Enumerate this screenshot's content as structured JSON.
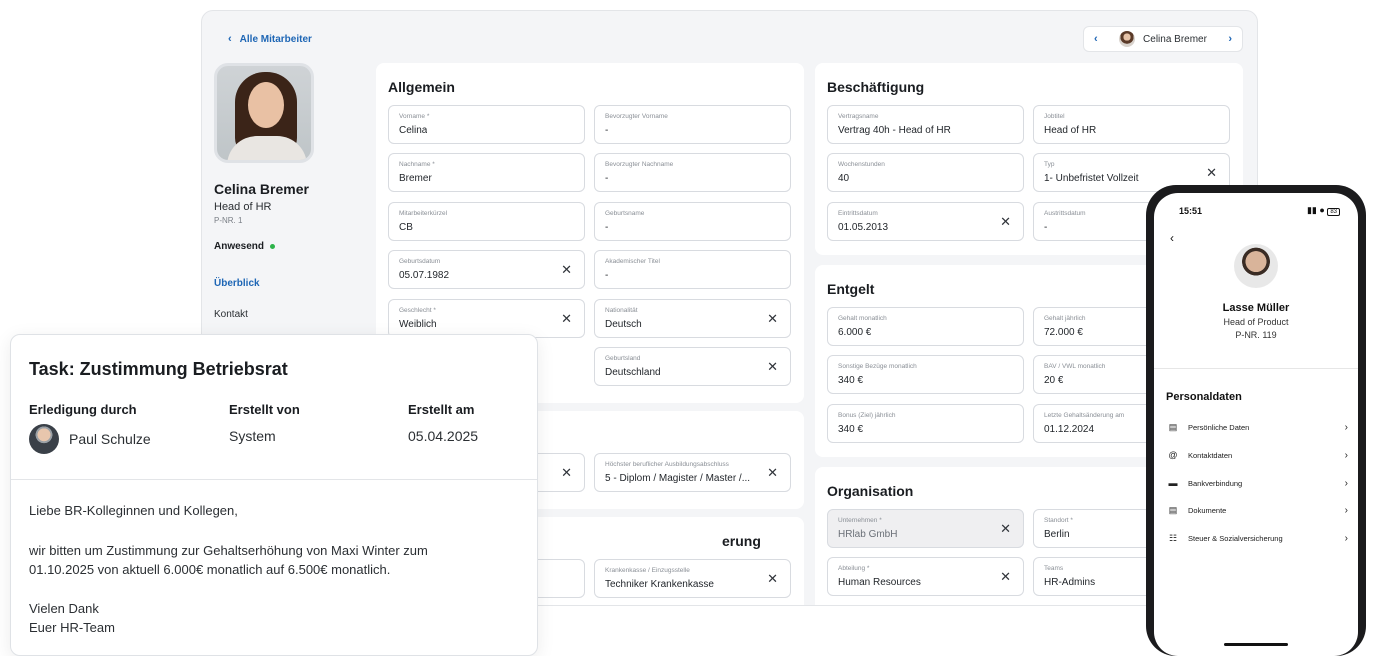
{
  "header": {
    "back_label": "Alle Mitarbeiter",
    "pager_name": "Celina Bremer"
  },
  "profile": {
    "name": "Celina Bremer",
    "role": "Head of HR",
    "nr": "P-NR. 1",
    "status": "Anwesend",
    "nav": [
      "Überblick",
      "Kontakt"
    ]
  },
  "allgemein": {
    "title": "Allgemein",
    "fields": [
      {
        "label": "Vorname *",
        "value": "Celina"
      },
      {
        "label": "Bevorzugter Vorname",
        "value": "-"
      },
      {
        "label": "Nachname *",
        "value": "Bremer"
      },
      {
        "label": "Bevorzugter Nachname",
        "value": "-"
      },
      {
        "label": "Mitarbeiterkürzel",
        "value": "CB"
      },
      {
        "label": "Geburtsname",
        "value": "-"
      },
      {
        "label": "Geburtsdatum",
        "value": "05.07.1982"
      },
      {
        "label": "Akademischer Titel",
        "value": "-"
      },
      {
        "label": "Geschlecht *",
        "value": "Weiblich"
      },
      {
        "label": "Nationalität",
        "value": "Deutsch"
      },
      {
        "label": "Geburtsland",
        "value": "Deutschland"
      }
    ]
  },
  "bildung": {
    "fields": [
      {
        "label": "Höchster beruflicher Ausbildungsabschluss",
        "value": "5 - Diplom / Magister / Master /..."
      }
    ]
  },
  "sozial": {
    "title_fragment": "erung",
    "fields": [
      {
        "label": "Krankenkasse / Einzugsstelle",
        "value": "Techniker Krankenkasse"
      }
    ]
  },
  "beschaeftigung": {
    "title": "Beschäftigung",
    "fields": [
      {
        "label": "Vertragsname",
        "value": "Vertrag 40h - Head of HR"
      },
      {
        "label": "Jobtitel",
        "value": "Head of HR"
      },
      {
        "label": "Wochenstunden",
        "value": "40"
      },
      {
        "label": "Typ",
        "value": "1- Unbefristet Vollzeit"
      },
      {
        "label": "Eintrittsdatum",
        "value": "01.05.2013"
      },
      {
        "label": "Austrittsdatum",
        "value": "-"
      }
    ]
  },
  "entgelt": {
    "title": "Entgelt",
    "fields": [
      {
        "label": "Gehalt monatlich",
        "value": "6.000 €"
      },
      {
        "label": "Gehalt jährlich",
        "value": "72.000 €"
      },
      {
        "label": "Sonstige Bezüge monatlich",
        "value": "340 €"
      },
      {
        "label": "BAV / VWL monatlich",
        "value": "20 €"
      },
      {
        "label": "Bonus (Ziel) jährlich",
        "value": "340 €"
      },
      {
        "label": "Letzte Gehaltsänderung am",
        "value": "01.12.2024"
      }
    ]
  },
  "organisation": {
    "title": "Organisation",
    "fields": [
      {
        "label": "Unternehmen *",
        "value": "HRlab GmbH"
      },
      {
        "label": "Standort *",
        "value": "Berlin"
      },
      {
        "label": "Abteilung *",
        "value": "Human Resources"
      },
      {
        "label": "Teams",
        "value": "HR-Admins"
      }
    ]
  },
  "task": {
    "title": "Task: Zustimmung Betriebsrat",
    "col1_label": "Erledigung durch",
    "col1_value": "Paul Schulze",
    "col2_label": "Erstellt von",
    "col2_value": "System",
    "col3_label": "Erstellt am",
    "col3_value": "05.04.2025",
    "greeting": "Liebe BR-Kolleginnen und Kollegen,",
    "body_line1": "wir bitten um Zustimmung zur Gehaltserhöhung von Maxi Winter zum",
    "body_line2": "01.10.2025 von aktuell 6.000€ monatlich auf 6.500€ monatlich.",
    "closing1": "Vielen Dank",
    "closing2": "Euer HR-Team"
  },
  "phone": {
    "time": "15:51",
    "status_icons": "signal wifi battery",
    "battery": "83",
    "name": "Lasse Müller",
    "role": "Head of Product",
    "nr": "P-NR. 119",
    "section": "Personaldaten",
    "items": [
      {
        "label": "Persönliche Daten",
        "icon": "id-card-icon"
      },
      {
        "label": "Kontaktdaten",
        "icon": "at-icon"
      },
      {
        "label": "Bankverbindung",
        "icon": "credit-card-icon"
      },
      {
        "label": "Dokumente",
        "icon": "document-icon"
      },
      {
        "label": "Steuer & Sozialversicherung",
        "icon": "bank-icon"
      }
    ]
  },
  "colors": {
    "accent": "#1e66b5",
    "status_green": "#2db34a",
    "panel_bg": "#f4f5f7"
  }
}
